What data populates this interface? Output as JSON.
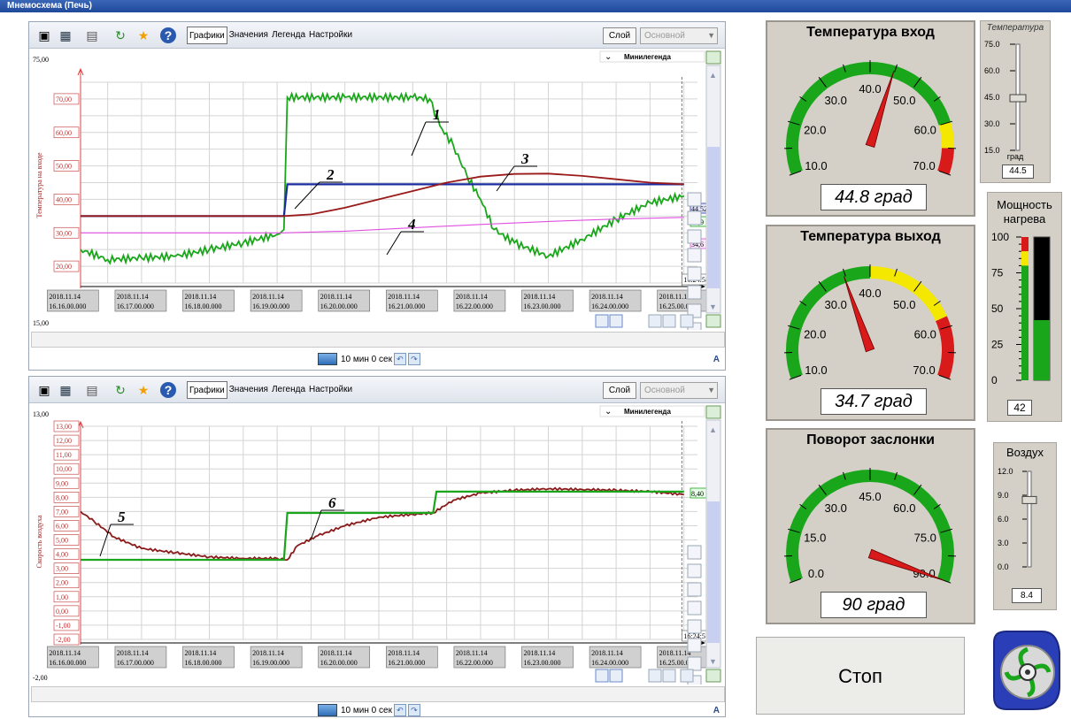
{
  "window_title": "Мнемосхема (Печь)",
  "toolbar": {
    "tabs": [
      "Графики",
      "Значения",
      "Легенда",
      "Настройки"
    ],
    "layer_button": "Слой",
    "layer_select": "Основной"
  },
  "top_chart": {
    "minilegend": "Минилегенда",
    "ylabel": "Температура на входе",
    "scale_top": "75,00",
    "scale_bottom": "15,00",
    "yticks": [
      "70,00",
      "60,00",
      "50,00",
      "40,00",
      "30,00",
      "20,00"
    ],
    "xticks": [
      [
        "2018.11.14",
        "16.16.00.000"
      ],
      [
        "2018.11.14",
        "16.17.00.000"
      ],
      [
        "2018.11.14",
        "16.18.00.000"
      ],
      [
        "2018.11.14",
        "16.19.00.000"
      ],
      [
        "2018.11.14",
        "16.20.00.000"
      ],
      [
        "2018.11.14",
        "16.21.00.000"
      ],
      [
        "2018.11.14",
        "16.22.00.000"
      ],
      [
        "2018.11.14",
        "16.23.00.000"
      ],
      [
        "2018.11.14",
        "16.24.00.000"
      ],
      [
        "2018.11.14",
        "16.25.00.000"
      ]
    ],
    "cursor_time": "16:24:58",
    "value_tags": [
      "44,52",
      "41,9",
      "34,6"
    ],
    "callouts": [
      "1",
      "2",
      "3",
      "4"
    ],
    "period": "10 мин 0 сек"
  },
  "bottom_chart": {
    "minilegend": "Минилегенда",
    "ylabel": "Скорость воздуха",
    "scale_top": "13,00",
    "scale_bottom": "-2,00",
    "yticks": [
      "13,00",
      "12,00",
      "11,00",
      "10,00",
      "9,00",
      "8,00",
      "7,00",
      "6,00",
      "5,00",
      "4,00",
      "3,00",
      "2,00",
      "1,00",
      "0,00",
      "-1,00",
      "-2,00"
    ],
    "xticks": [
      [
        "2018.11.14",
        "16.16.00.000"
      ],
      [
        "2018.11.14",
        "16.17.00.000"
      ],
      [
        "2018.11.14",
        "16.18.00.000"
      ],
      [
        "2018.11.14",
        "16.19.00.000"
      ],
      [
        "2018.11.14",
        "16.20.00.000"
      ],
      [
        "2018.11.14",
        "16.21.00.000"
      ],
      [
        "2018.11.14",
        "16.22.00.000"
      ],
      [
        "2018.11.14",
        "16.23.00.000"
      ],
      [
        "2018.11.14",
        "16.24.00.000"
      ],
      [
        "2018.11.14",
        "16.25.00.000"
      ]
    ],
    "cursor_time": "16:24:57",
    "value_tags": [
      "8,40"
    ],
    "callouts": [
      "5",
      "6"
    ],
    "period": "10 мин 0 сек"
  },
  "chart_data": [
    {
      "type": "line",
      "ylabel": "Температура на входе",
      "ylim": [
        15,
        75
      ],
      "xlim": [
        16.1,
        25.2
      ],
      "x_unit": "minutes after 16:00",
      "series": [
        {
          "label": "1",
          "color": "#1aa61a",
          "x": [
            16.1,
            16.5,
            17,
            17.5,
            18,
            18.5,
            19,
            19.1,
            19.15,
            20,
            21,
            21.25,
            21.4,
            21.6,
            21.8,
            22,
            22.2,
            22.5,
            23,
            23.5,
            24,
            24.5,
            25.0
          ],
          "y": [
            25,
            22,
            22.5,
            23,
            25,
            27,
            29.5,
            31,
            70.5,
            70.5,
            70.5,
            70,
            62,
            56,
            47,
            40,
            31,
            27,
            23,
            28,
            34,
            39,
            41
          ]
        },
        {
          "label": "2",
          "color": "#1a2aa0",
          "x": [
            16.1,
            19.1,
            19.15,
            25.0
          ],
          "y": [
            35,
            35,
            44.5,
            44.5
          ]
        },
        {
          "label": "3",
          "color": "#9a1a1a",
          "x": [
            16.1,
            19.1,
            19.5,
            20,
            20.5,
            21,
            21.5,
            22,
            22.5,
            23,
            23.5,
            24,
            24.5,
            25.0
          ],
          "y": [
            35,
            35,
            35.5,
            37.5,
            40,
            42.5,
            45,
            46.8,
            47.6,
            47.7,
            47,
            46,
            45,
            44.5
          ]
        },
        {
          "label": "4",
          "color": "#e050e0",
          "x": [
            16.1,
            19.1,
            20,
            21,
            22,
            23,
            24,
            25.0
          ],
          "y": [
            30,
            30,
            30.5,
            31.5,
            32.5,
            33.4,
            34.1,
            34.6
          ]
        }
      ]
    },
    {
      "type": "line",
      "ylabel": "Скорость воздуха",
      "ylim": [
        -2,
        13
      ],
      "xlim": [
        16.1,
        25.2
      ],
      "x_unit": "minutes after 16:00",
      "series": [
        {
          "label": "5",
          "color": "#8b1a1a",
          "x": [
            16.1,
            16.3,
            16.6,
            17,
            17.5,
            18,
            18.5,
            19,
            19.15,
            19.3,
            19.6,
            20,
            20.5,
            21,
            21.3,
            21.6,
            22,
            22.5,
            23,
            23.5,
            24,
            24.5,
            25.0
          ],
          "y": [
            7,
            6.3,
            5.2,
            4.4,
            4.1,
            3.8,
            3.7,
            3.7,
            3.6,
            4.6,
            5.3,
            6.0,
            6.6,
            6.8,
            6.9,
            7.8,
            8.3,
            8.5,
            8.6,
            8.55,
            8.5,
            8.4,
            8.2
          ]
        },
        {
          "label": "6",
          "color": "#1aa61a",
          "x": [
            16.1,
            19.1,
            19.15,
            21.3,
            21.35,
            25.0
          ],
          "y": [
            3.6,
            3.6,
            6.9,
            6.9,
            8.4,
            8.4
          ]
        }
      ]
    }
  ],
  "gauges": [
    {
      "title": "Температура вход",
      "ticks": [
        "10.0",
        "20.0",
        "30.0",
        "40.0",
        "50.0",
        "60.0",
        "70.0"
      ],
      "value": 44.8,
      "min": 10,
      "max": 70,
      "display": "44.8 град",
      "green_to": 60,
      "yellow_to": 65
    },
    {
      "title": "Температура выход",
      "ticks": [
        "10.0",
        "20.0",
        "30.0",
        "40.0",
        "50.0",
        "60.0",
        "70.0"
      ],
      "value": 34.7,
      "min": 10,
      "max": 70,
      "display": "34.7 град",
      "green_to": 40,
      "yellow_to": 58
    },
    {
      "title": "Поворот заслонки",
      "ticks": [
        "0.0",
        "15.0",
        "30.0",
        "45.0",
        "60.0",
        "75.0",
        "90.0"
      ],
      "value": 90,
      "min": 0,
      "max": 90,
      "display": "90 град",
      "green_to": 90,
      "yellow_to": 90
    }
  ],
  "temp_slider": {
    "title": "Температура",
    "ticks": [
      "75.0",
      "60.0",
      "45.0",
      "30.0",
      "15.0"
    ],
    "unit": "град",
    "value": "44.5",
    "level": 44.5,
    "min": 15,
    "max": 75
  },
  "power": {
    "title_line1": "Мощность",
    "title_line2": "нагрева",
    "ticks": [
      "100",
      "75",
      "50",
      "25",
      "0"
    ],
    "value": "42",
    "level": 42
  },
  "air_slider": {
    "title": "Воздух",
    "ticks": [
      "12.0",
      "9.0",
      "6.0",
      "3.0",
      "0.0"
    ],
    "value": "8.4",
    "level": 8.4,
    "min": 0,
    "max": 12
  },
  "stop_button": "Стоп",
  "colors": {
    "green": "#1aa61a",
    "yellow": "#f5e800",
    "red": "#d81a1a",
    "panel": "#d4d0c8"
  }
}
